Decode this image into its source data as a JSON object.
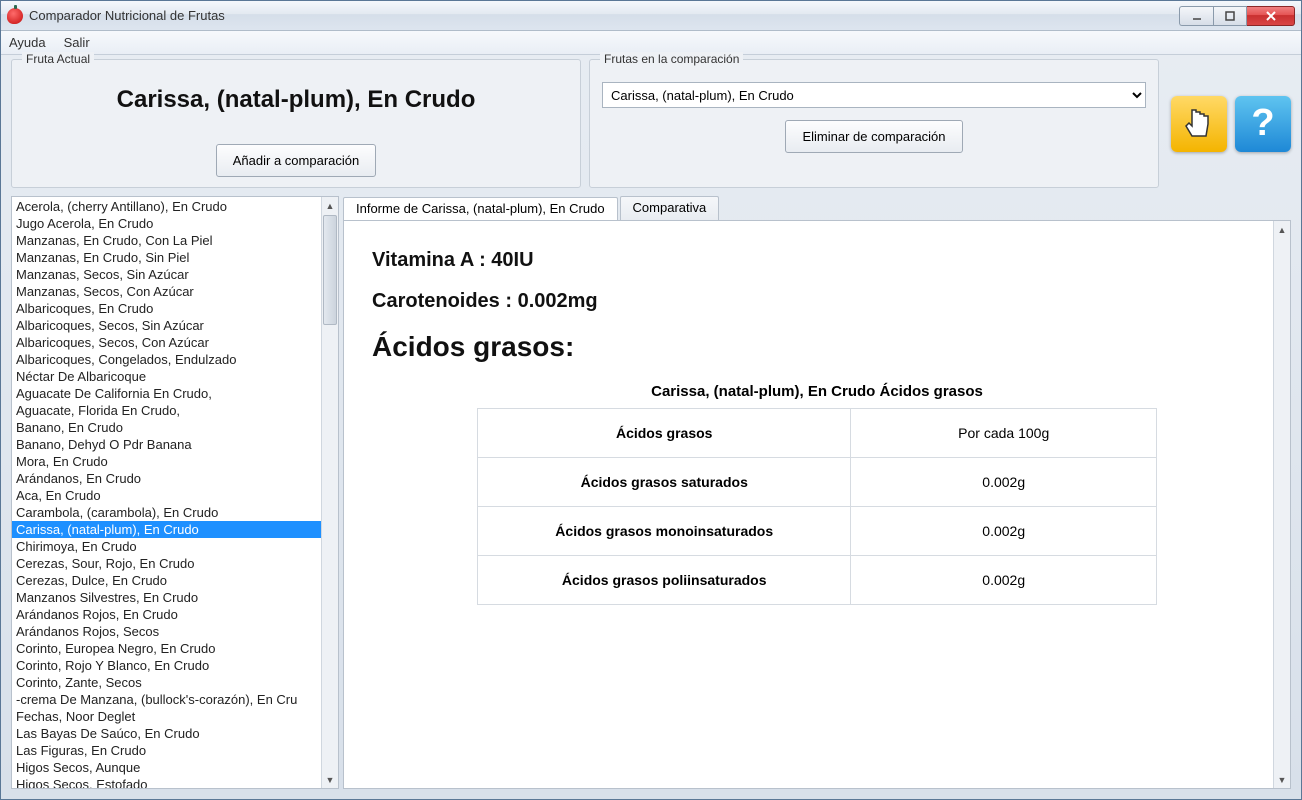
{
  "window": {
    "title": "Comparador Nutricional de Frutas"
  },
  "menu": {
    "help": "Ayuda",
    "exit": "Salir"
  },
  "panels": {
    "current_legend": "Fruta Actual",
    "current_fruit": "Carissa, (natal-plum), En Crudo",
    "add_button": "Añadir a comparación",
    "comparison_legend": "Frutas en la comparación",
    "comparison_selected": "Carissa, (natal-plum), En Crudo",
    "remove_button": "Eliminar de comparación"
  },
  "fruit_list": {
    "selected_index": 19,
    "items": [
      "Acerola, (cherry Antillano), En Crudo",
      "Jugo Acerola, En Crudo",
      "Manzanas, En Crudo, Con La Piel",
      "Manzanas, En Crudo, Sin Piel",
      "Manzanas, Secos, Sin Azúcar",
      "Manzanas, Secos, Con Azúcar",
      "Albaricoques, En Crudo",
      "Albaricoques, Secos, Sin Azúcar",
      "Albaricoques, Secos, Con Azúcar",
      "Albaricoques, Congelados, Endulzado",
      "Néctar De Albaricoque",
      "Aguacate De California En Crudo,",
      "Aguacate, Florida En Crudo,",
      "Banano, En Crudo",
      "Banano, Dehyd O Pdr Banana",
      "Mora, En Crudo",
      "Arándanos, En Crudo",
      "Aca, En Crudo",
      "Carambola, (carambola), En Crudo",
      "Carissa, (natal-plum), En Crudo",
      "Chirimoya, En Crudo",
      "Cerezas, Sour, Rojo, En Crudo",
      "Cerezas, Dulce, En Crudo",
      "Manzanos Silvestres, En Crudo",
      "Arándanos Rojos, En Crudo",
      "Arándanos Rojos, Secos",
      "Corinto, Europea Negro, En Crudo",
      "Corinto, Rojo Y Blanco, En Crudo",
      "Corinto, Zante, Secos",
      "-crema De Manzana, (bullock's-corazón), En Cru",
      "Fechas, Noor Deglet",
      "Las Bayas De Saúco, En Crudo",
      "Las Figuras, En Crudo",
      "Higos Secos, Aunque",
      "Higos Secos, Estofado"
    ]
  },
  "tabs": {
    "report": "Informe de Carissa, (natal-plum), En Crudo",
    "compare": "Comparativa"
  },
  "report": {
    "vitamin_a_line": "Vitamina A : 40IU",
    "carotenoids_line": "Carotenoides : 0.002mg",
    "fatty_section": "Ácidos grasos:",
    "table_caption": "Carissa, (natal-plum), En Crudo Ácidos grasos",
    "col_header_left": "Ácidos grasos",
    "col_header_right": "Por cada 100g",
    "rows": [
      {
        "label": "Ácidos grasos saturados",
        "value": "0.002g"
      },
      {
        "label": "Ácidos grasos monoinsaturados",
        "value": "0.002g"
      },
      {
        "label": "Ácidos grasos poliinsaturados",
        "value": "0.002g"
      }
    ]
  }
}
